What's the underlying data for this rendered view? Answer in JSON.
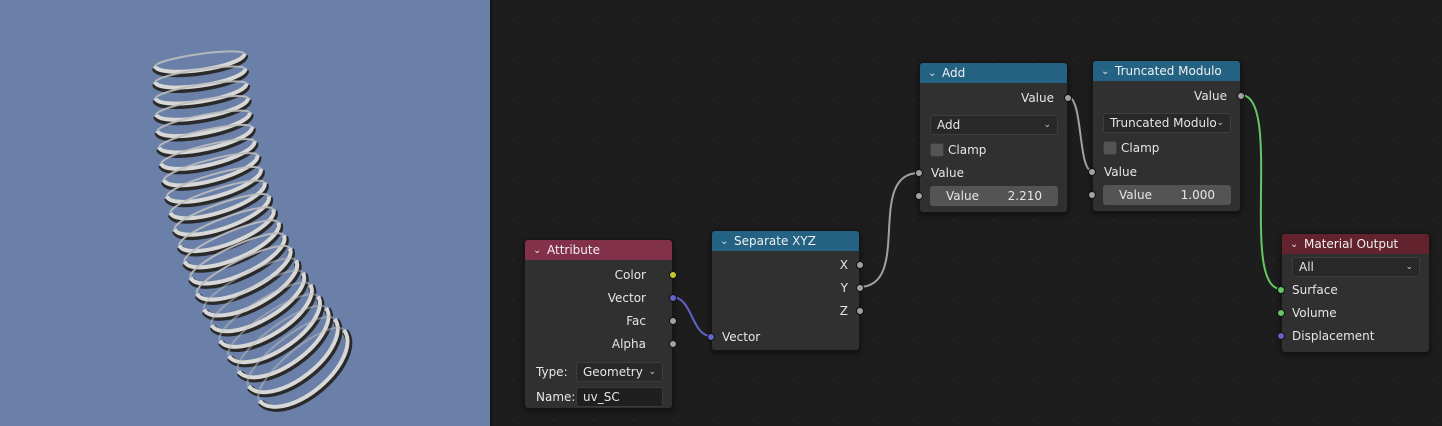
{
  "viewport": {
    "background": "#6a80a8",
    "object": "ribbed-tube-render"
  },
  "nodes": {
    "attribute": {
      "title": "Attribute",
      "outputs": [
        "Color",
        "Vector",
        "Fac",
        "Alpha"
      ],
      "type_label": "Type:",
      "type_value": "Geometry",
      "name_label": "Name:",
      "name_value": "uv_SC"
    },
    "separate_xyz": {
      "title": "Separate XYZ",
      "outputs": [
        "X",
        "Y",
        "Z"
      ],
      "input": "Vector"
    },
    "add": {
      "title": "Add",
      "output": "Value",
      "operation": "Add",
      "clamp_label": "Clamp",
      "input_socket": "Value",
      "value_label": "Value",
      "value": "2.210"
    },
    "trunc_mod": {
      "title": "Truncated Modulo",
      "output": "Value",
      "operation": "Truncated Modulo",
      "clamp_label": "Clamp",
      "input_socket": "Value",
      "value_label": "Value",
      "value": "1.000"
    },
    "material_output": {
      "title": "Material Output",
      "target": "All",
      "inputs": [
        "Surface",
        "Volume",
        "Displacement"
      ]
    }
  },
  "colors": {
    "attribute_header": "#83314a",
    "math_header": "#246283",
    "output_header": "#63232e",
    "socket_color": "#c7c729",
    "socket_vector": "#6363c7",
    "socket_float": "#a1a1a1",
    "socket_shader": "#63c763"
  }
}
